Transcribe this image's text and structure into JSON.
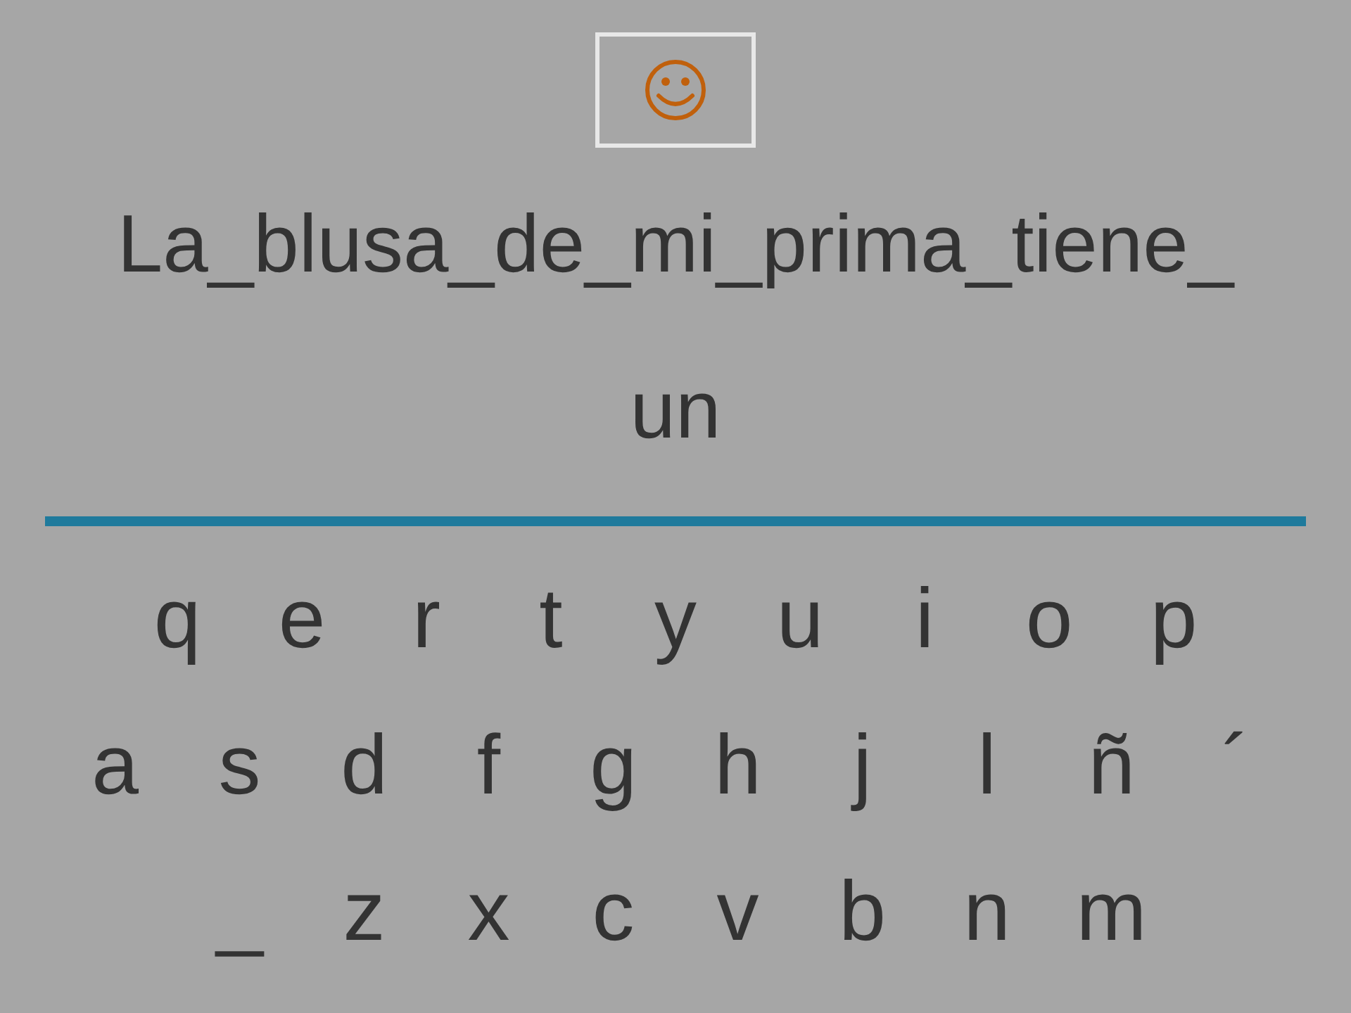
{
  "prompt": {
    "lines": [
      "La_blusa_de_mi_prima_tiene_",
      "un"
    ]
  },
  "keyboard": {
    "rows": [
      [
        "q",
        "e",
        "r",
        "t",
        "y",
        "u",
        "i",
        "o",
        "p"
      ],
      [
        "a",
        "s",
        "d",
        "f",
        "g",
        "h",
        "j",
        "l",
        "ñ",
        "´"
      ],
      [
        "_",
        "z",
        "x",
        "c",
        "v",
        "b",
        "n",
        "m"
      ]
    ]
  }
}
